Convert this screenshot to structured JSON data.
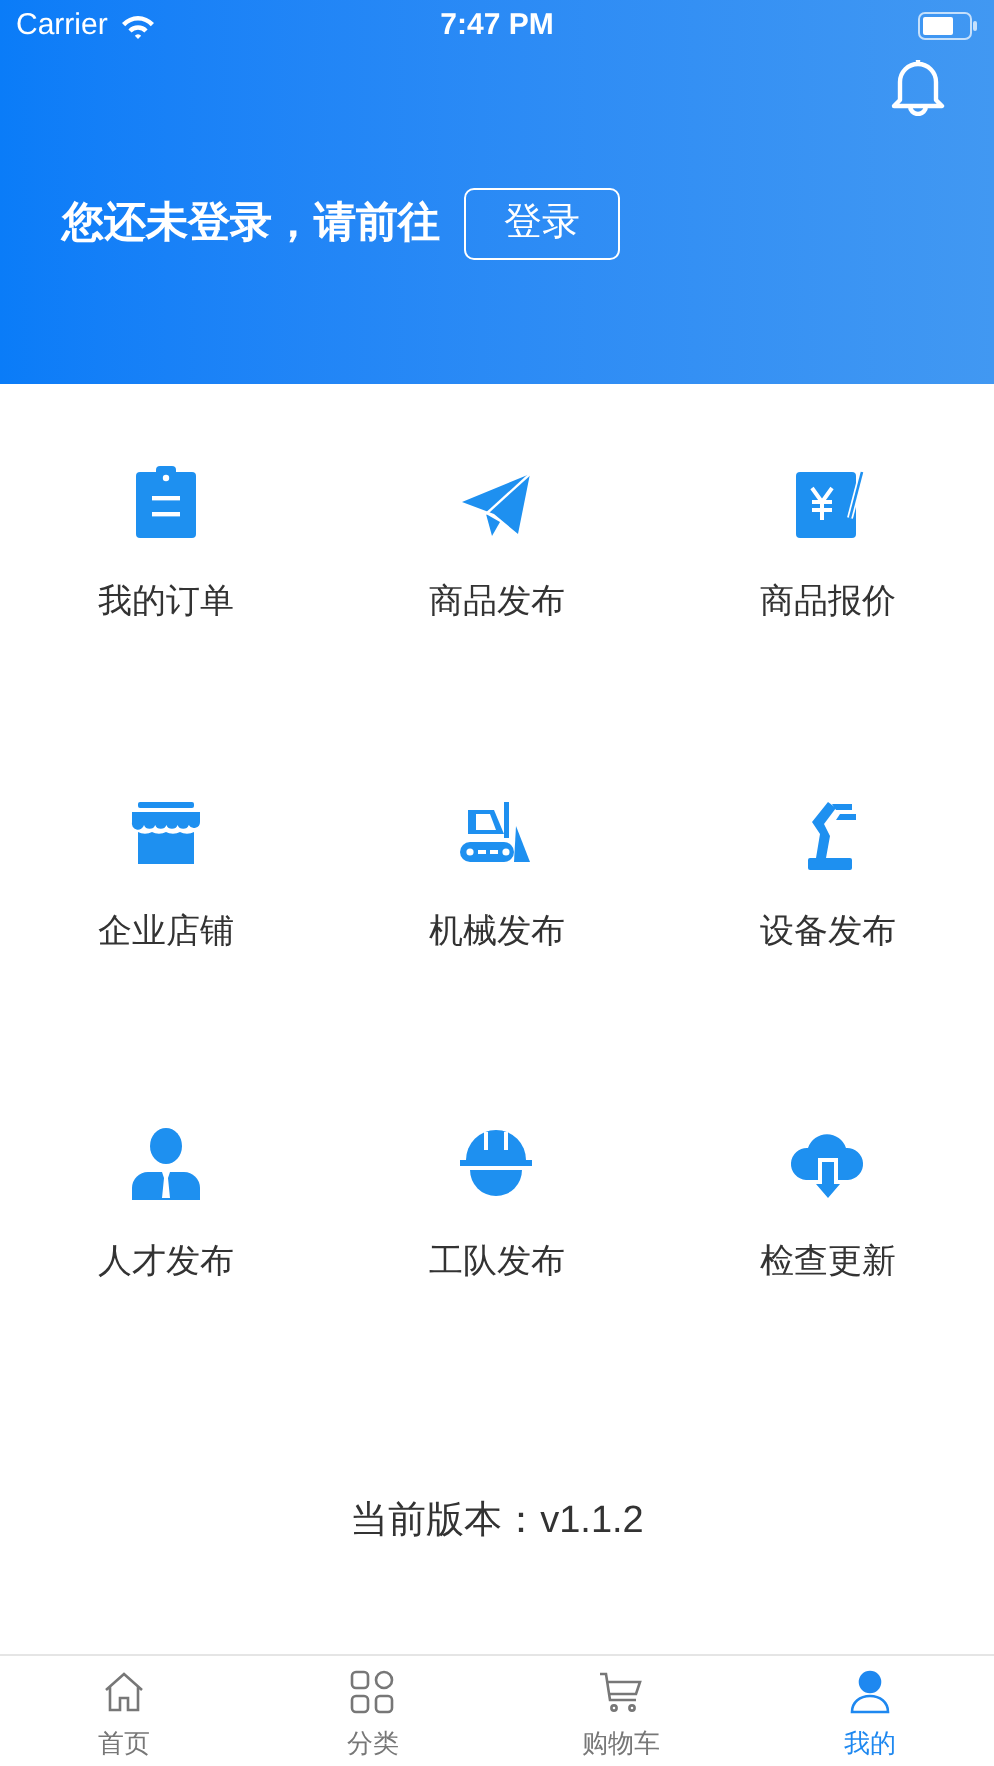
{
  "status_bar": {
    "carrier": "Carrier",
    "time": "7:47 PM"
  },
  "header": {
    "prompt": "您还未登录，请前往",
    "login_button": "登录"
  },
  "menu": [
    {
      "label": "我的订单"
    },
    {
      "label": "商品发布"
    },
    {
      "label": "商品报价"
    },
    {
      "label": "企业店铺"
    },
    {
      "label": "机械发布"
    },
    {
      "label": "设备发布"
    },
    {
      "label": "人才发布"
    },
    {
      "label": "工队发布"
    },
    {
      "label": "检查更新"
    }
  ],
  "version": "当前版本：v1.1.2",
  "tab_bar": [
    {
      "label": "首页",
      "selected": false
    },
    {
      "label": "分类",
      "selected": false
    },
    {
      "label": "购物车",
      "selected": false
    },
    {
      "label": "我的",
      "selected": true
    }
  ]
}
